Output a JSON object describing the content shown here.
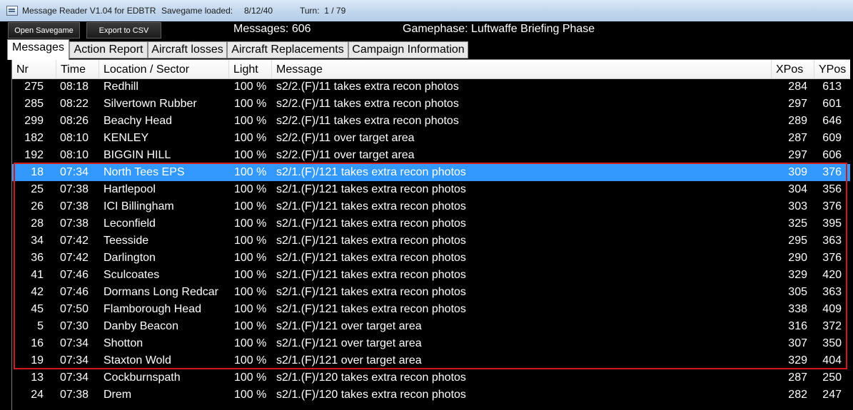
{
  "window": {
    "title": "Message Reader V1.04 for EDBTR",
    "savegame_label": "Savegame loaded:",
    "savegame_date": "8/12/40",
    "turn": "Turn:  1 / 79"
  },
  "toolbar": {
    "open_label": "Open Savegame",
    "export_label": "Export to CSV",
    "messages_count": "Messages: 606",
    "gamephase": "Gamephase: Luftwaffe Briefing Phase"
  },
  "tabs": [
    {
      "label": "Messages",
      "active": true
    },
    {
      "label": "Action Report"
    },
    {
      "label": "Aircraft losses"
    },
    {
      "label": "Aircraft Replacements"
    },
    {
      "label": "Campaign Information"
    }
  ],
  "columns": {
    "nr": "Nr",
    "time": "Time",
    "location": "Location / Sector",
    "light": "Light",
    "message": "Message",
    "xpos": "XPos",
    "ypos": "YPos"
  },
  "rows": [
    {
      "nr": "275",
      "time": "08:18",
      "location": "Redhill",
      "light": "100 %",
      "message": "s2/2.(F)/11 takes extra recon photos",
      "xpos": "284",
      "ypos": "613"
    },
    {
      "nr": "285",
      "time": "08:22",
      "location": "Silvertown Rubber",
      "light": "100 %",
      "message": "s2/2.(F)/11 takes extra recon photos",
      "xpos": "297",
      "ypos": "601"
    },
    {
      "nr": "299",
      "time": "08:26",
      "location": "Beachy Head",
      "light": "100 %",
      "message": "s2/2.(F)/11 takes extra recon photos",
      "xpos": "289",
      "ypos": "646"
    },
    {
      "nr": "182",
      "time": "08:10",
      "location": "KENLEY",
      "light": "100 %",
      "message": "s2/2.(F)/11 over target area",
      "xpos": "287",
      "ypos": "609"
    },
    {
      "nr": "192",
      "time": "08:10",
      "location": "BIGGIN HILL",
      "light": "100 %",
      "message": "s2/2.(F)/11 over target area",
      "xpos": "297",
      "ypos": "606"
    },
    {
      "nr": "18",
      "time": "07:34",
      "location": "North Tees EPS",
      "light": "100 %",
      "message": "s2/1.(F)/121 takes extra recon photos",
      "xpos": "309",
      "ypos": "376",
      "selected": true
    },
    {
      "nr": "25",
      "time": "07:38",
      "location": "Hartlepool",
      "light": "100 %",
      "message": "s2/1.(F)/121 takes extra recon photos",
      "xpos": "304",
      "ypos": "356"
    },
    {
      "nr": "26",
      "time": "07:38",
      "location": "ICI Billingham",
      "light": "100 %",
      "message": "s2/1.(F)/121 takes extra recon photos",
      "xpos": "303",
      "ypos": "376"
    },
    {
      "nr": "28",
      "time": "07:38",
      "location": "Leconfield",
      "light": "100 %",
      "message": "s2/1.(F)/121 takes extra recon photos",
      "xpos": "325",
      "ypos": "395"
    },
    {
      "nr": "34",
      "time": "07:42",
      "location": "Teesside",
      "light": "100 %",
      "message": "s2/1.(F)/121 takes extra recon photos",
      "xpos": "295",
      "ypos": "363"
    },
    {
      "nr": "36",
      "time": "07:42",
      "location": "Darlington",
      "light": "100 %",
      "message": "s2/1.(F)/121 takes extra recon photos",
      "xpos": "290",
      "ypos": "376"
    },
    {
      "nr": "41",
      "time": "07:46",
      "location": "Sculcoates",
      "light": "100 %",
      "message": "s2/1.(F)/121 takes extra recon photos",
      "xpos": "329",
      "ypos": "420"
    },
    {
      "nr": "42",
      "time": "07:46",
      "location": "Dormans Long Redcar",
      "light": "100 %",
      "message": "s2/1.(F)/121 takes extra recon photos",
      "xpos": "305",
      "ypos": "363"
    },
    {
      "nr": "45",
      "time": "07:50",
      "location": "Flamborough Head",
      "light": "100 %",
      "message": "s2/1.(F)/121 takes extra recon photos",
      "xpos": "338",
      "ypos": "409"
    },
    {
      "nr": "5",
      "time": "07:30",
      "location": "Danby Beacon",
      "light": "100 %",
      "message": "s2/1.(F)/121 over target area",
      "xpos": "316",
      "ypos": "372"
    },
    {
      "nr": "16",
      "time": "07:34",
      "location": "Shotton",
      "light": "100 %",
      "message": "s2/1.(F)/121 over target area",
      "xpos": "307",
      "ypos": "350"
    },
    {
      "nr": "19",
      "time": "07:34",
      "location": "Staxton Wold",
      "light": "100 %",
      "message": "s2/1.(F)/121 over target area",
      "xpos": "329",
      "ypos": "404"
    },
    {
      "nr": "13",
      "time": "07:34",
      "location": "Cockburnspath",
      "light": "100 %",
      "message": "s2/1.(F)/120 takes extra recon photos",
      "xpos": "287",
      "ypos": "250"
    },
    {
      "nr": "24",
      "time": "07:38",
      "location": "Drem",
      "light": "100 %",
      "message": "s2/1.(F)/120 takes extra recon photos",
      "xpos": "282",
      "ypos": "247"
    }
  ],
  "colors": {
    "selection": "#3399ff",
    "highlight_border": "#d21a1a",
    "background": "#000000"
  }
}
